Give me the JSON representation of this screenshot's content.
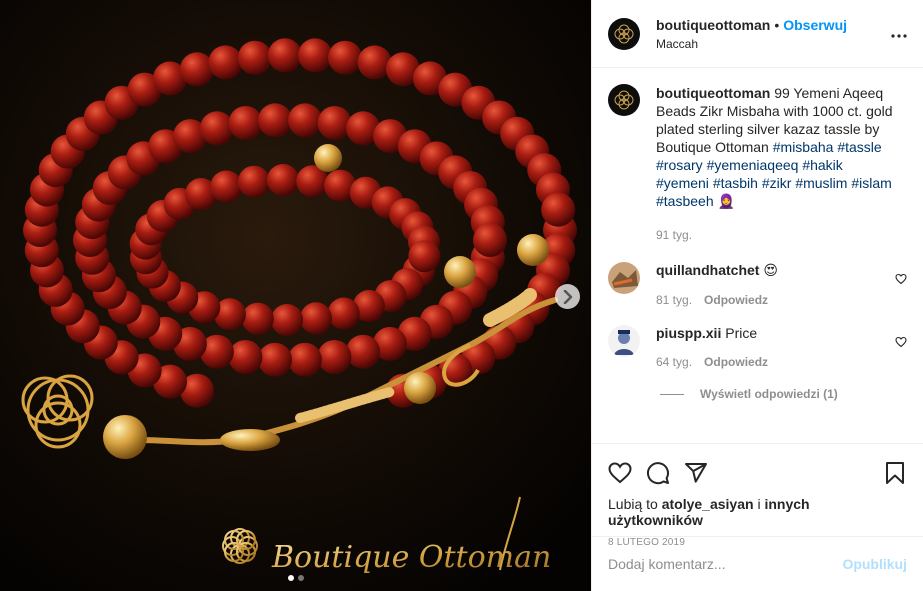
{
  "post": {
    "brand_watermark": "Boutique Ottoman",
    "carousel": {
      "count": 2,
      "active": 1
    }
  },
  "header": {
    "username": "boutiqueottoman",
    "separator": "•",
    "follow_label": "Obserwuj",
    "location": "Maccah"
  },
  "caption": {
    "username": "boutiqueottoman",
    "text": "99 Yemeni Aqeeq Beads Zikr Misbaha with 1000 ct. gold plated sterling silver kazaz tassle by Boutique Ottoman",
    "hashtags": [
      "#misbaha",
      "#tassle",
      "#rosary",
      "#yemeniaqeeq",
      "#hakik",
      "#yemeni",
      "#tasbih",
      "#zikr",
      "#muslim",
      "#islam",
      "#tasbeeh"
    ],
    "emoji": "🧕",
    "age": "91 tyg."
  },
  "comments": [
    {
      "username": "quillandhatchet",
      "text": "😍",
      "age": "81 tyg.",
      "reply_label": "Odpowiedz"
    },
    {
      "username": "piuspp.xii",
      "text": "Price",
      "age": "64 tyg.",
      "reply_label": "Odpowiedz"
    }
  ],
  "view_replies_label": "Wyświetl odpowiedzi (1)",
  "likes": {
    "prefix": "Lubią to",
    "user": "atolye_asiyan",
    "and": "i",
    "others": "innych użytkowników"
  },
  "date": "8 LUTEGO 2019",
  "comment_input": {
    "placeholder": "Dodaj komentarz...",
    "value": ""
  },
  "publish_label": "Opublikuj",
  "icons": {
    "more": "more-icon",
    "like": "heart-icon",
    "comment": "comment-icon",
    "share": "share-icon",
    "save": "bookmark-icon",
    "next": "chevron-right-icon"
  },
  "colors": {
    "link": "#00376b",
    "follow": "#0095f6",
    "muted": "#8e8e8e",
    "publish_disabled": "#b2dffc"
  }
}
